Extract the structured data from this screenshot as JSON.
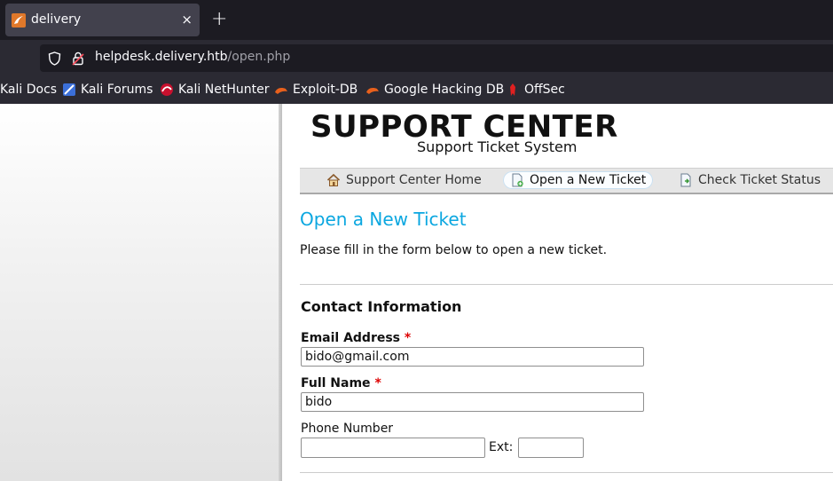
{
  "browser": {
    "tab_title": "delivery",
    "tab_close": "×",
    "new_tab": "+",
    "url_host": "helpdesk.delivery.htb",
    "url_path": "/open.php",
    "bookmarks": [
      {
        "label": "Kali Docs",
        "icon": "kali-docs-icon"
      },
      {
        "label": "Kali Forums",
        "icon": "kali-forums-icon"
      },
      {
        "label": "Kali NetHunter",
        "icon": "kali-nethunter-icon"
      },
      {
        "label": "Exploit-DB",
        "icon": "exploit-db-icon"
      },
      {
        "label": "Google Hacking DB",
        "icon": "google-hacking-db-icon"
      },
      {
        "label": "OffSec",
        "icon": "offsec-icon"
      }
    ]
  },
  "header": {
    "logo_title": "SUPPORT CENTER",
    "logo_subtitle": "Support Ticket System"
  },
  "nav": {
    "home": "Support Center Home",
    "open_ticket": "Open a New Ticket",
    "check_status": "Check Ticket Status"
  },
  "content": {
    "heading": "Open a New Ticket",
    "intro": "Please fill in the form below to open a new ticket.",
    "section_title": "Contact Information"
  },
  "form": {
    "email_label": "Email Address",
    "email_value": "bido@gmail.com",
    "name_label": "Full Name",
    "name_value": "bido",
    "phone_label": "Phone Number",
    "phone_value": "",
    "ext_label": "Ext:",
    "ext_value": "",
    "required_marker": "*"
  },
  "colors": {
    "heading": "#0ba7e0",
    "required": "#dd0000",
    "chrome_dark": "#1c1b22",
    "chrome": "#2b2a33"
  }
}
